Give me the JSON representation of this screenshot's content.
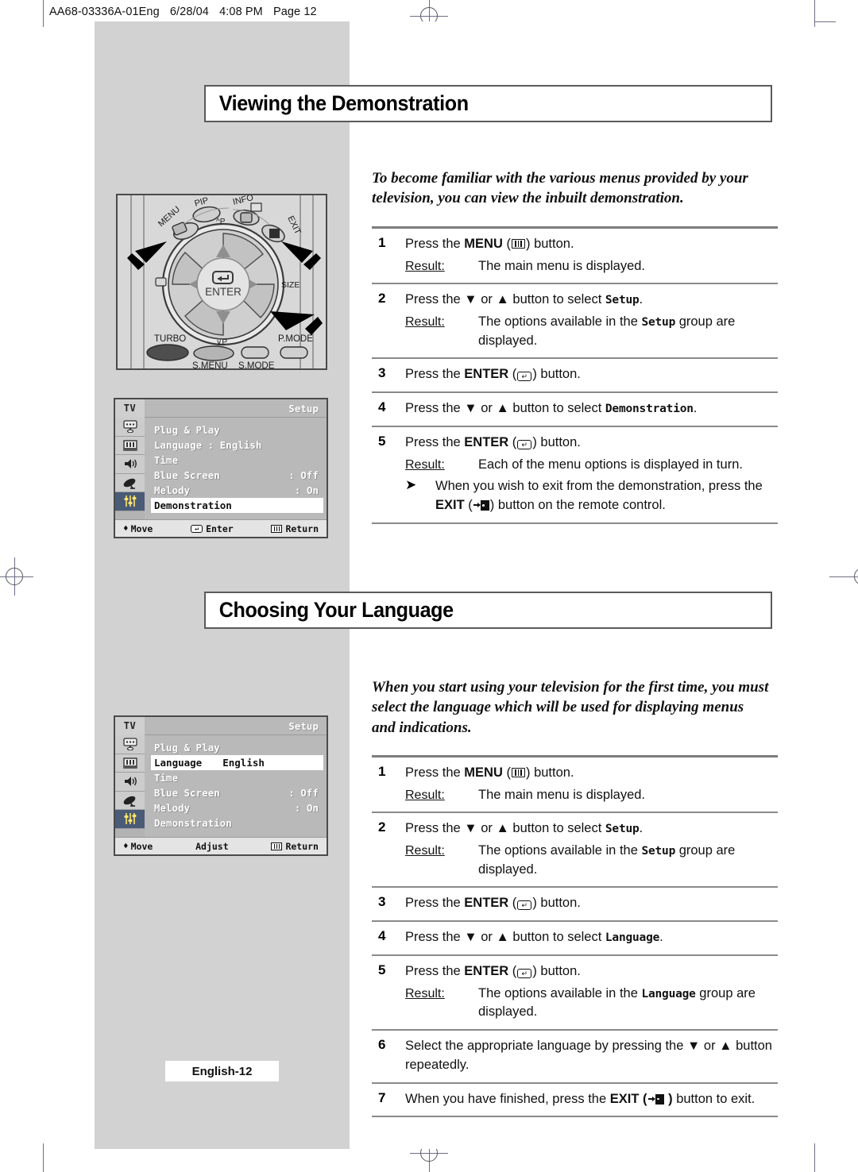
{
  "page_header": {
    "doc_code": "AA68-03336A-01Eng",
    "date": "6/28/04",
    "time": "4:08 PM",
    "page": "Page 12"
  },
  "footer": {
    "label": "English-12"
  },
  "sections": [
    {
      "title": "Viewing the Demonstration",
      "intro": "To become familiar with the various menus provided by your television, you can view the inbuilt demonstration.",
      "steps": [
        {
          "num": "1",
          "pre": "Press the ",
          "kw": "MENU",
          "glyph": "menu-glyph",
          "post": " button.",
          "result_label": "Result:",
          "result": "The main menu is displayed."
        },
        {
          "num": "2",
          "text_a": "Press the ",
          "arrows": "▼ or ▲",
          "text_b": " button to select ",
          "mono": "Setup",
          "text_c": ".",
          "result_label": "Result:",
          "result_a": "The options available in the ",
          "result_mono": "Setup",
          "result_b": " group are displayed."
        },
        {
          "num": "3",
          "pre": "Press the ",
          "kw": "ENTER",
          "glyph": "enter-glyph",
          "post": " button."
        },
        {
          "num": "4",
          "text_a": "Press the ",
          "arrows": "▼ or ▲",
          "text_b": " button to select ",
          "mono": "Demonstration",
          "text_c": "."
        },
        {
          "num": "5",
          "pre": "Press the ",
          "kw": "ENTER",
          "glyph": "enter-glyph",
          "post": " button.",
          "result_label": "Result:",
          "result": "Each of the menu options is displayed in turn.",
          "note_a": "When you wish to exit from the demonstration, press the ",
          "note_kw": "EXIT",
          "note_glyph": "exit-glyph",
          "note_b": " button on the remote control."
        }
      ]
    },
    {
      "title": "Choosing Your Language",
      "intro": "When you start using your television for the first time, you must select the language which will be used for displaying menus and indications.",
      "steps": [
        {
          "num": "1",
          "pre": "Press the ",
          "kw": "MENU",
          "glyph": "menu-glyph",
          "post": " button.",
          "result_label": "Result:",
          "result": "The main menu is displayed."
        },
        {
          "num": "2",
          "text_a": "Press the ",
          "arrows": "▼ or ▲",
          "text_b": " button to select ",
          "mono": "Setup",
          "text_c": ".",
          "result_label": "Result:",
          "result_a": "The options available in the ",
          "result_mono": "Setup",
          "result_b": " group are displayed."
        },
        {
          "num": "3",
          "pre": "Press the ",
          "kw": "ENTER",
          "glyph": "enter-glyph",
          "post": " button."
        },
        {
          "num": "4",
          "text_a": "Press the ",
          "arrows": "▼ or ▲",
          "text_b": " button to select ",
          "mono": "Language",
          "text_c": "."
        },
        {
          "num": "5",
          "pre": "Press the ",
          "kw": "ENTER",
          "glyph": "enter-glyph",
          "post": " button.",
          "result_label": "Result:",
          "result_a": "The options available in the ",
          "result_mono": "Language",
          "result_b": " group are displayed."
        },
        {
          "num": "6",
          "text_a": "Select the appropriate language by pressing the ",
          "arrows": "▼ or ▲",
          "text_b": " button repeatedly.",
          "mono": "",
          "text_c": ""
        },
        {
          "num": "7",
          "pre": "When you have finished, press the ",
          "kw": "EXIT",
          "glyph": "exit-glyph",
          "post": " button to exit."
        }
      ]
    }
  ],
  "remote": {
    "labels": {
      "menu": "MENU",
      "pip": "PIP",
      "info": "INFO",
      "exit": "EXIT",
      "enter": "ENTER",
      "up_p": "P",
      "down_p": "P",
      "size": "SIZE",
      "turbo": "TURBO",
      "smenu": "S.MENU",
      "smode": "S.MODE",
      "pmode": "P.MODE"
    }
  },
  "osd": [
    {
      "tv_label": "TV",
      "title": "Setup",
      "rows": [
        {
          "label": "Plug & Play",
          "value": "",
          "highlight": false
        },
        {
          "label": "Language  : English",
          "value": "",
          "highlight": false
        },
        {
          "label": "Time",
          "value": "",
          "highlight": false
        },
        {
          "label": "Blue Screen",
          "value": ": Off",
          "highlight": false
        },
        {
          "label": "Melody",
          "value": ": On",
          "highlight": false
        },
        {
          "label": "Demonstration",
          "value": "",
          "highlight": true
        }
      ],
      "bottom": {
        "move": "Move",
        "middle": "Enter",
        "return": "Return",
        "middle_icon": "enter-glyph"
      }
    },
    {
      "tv_label": "TV",
      "title": "Setup",
      "rows": [
        {
          "label": "Plug & Play",
          "value": "",
          "highlight": false
        },
        {
          "label": "Language",
          "value": "English",
          "highlight": true
        },
        {
          "label": "Time",
          "value": "",
          "highlight": false
        },
        {
          "label": "Blue Screen",
          "value": ": Off",
          "highlight": false
        },
        {
          "label": "Melody",
          "value": ": On",
          "highlight": false
        },
        {
          "label": "Demonstration",
          "value": "",
          "highlight": false
        }
      ],
      "bottom": {
        "move": "Move",
        "middle": "Adjust",
        "return": "Return",
        "middle_icon": "none"
      }
    }
  ],
  "colors": {
    "grey_panel": "#d2d2d2",
    "osd_bg": "#b9b9b9",
    "osd_selected_icon": "#4a5b78",
    "rule": "#7d7d7d"
  }
}
